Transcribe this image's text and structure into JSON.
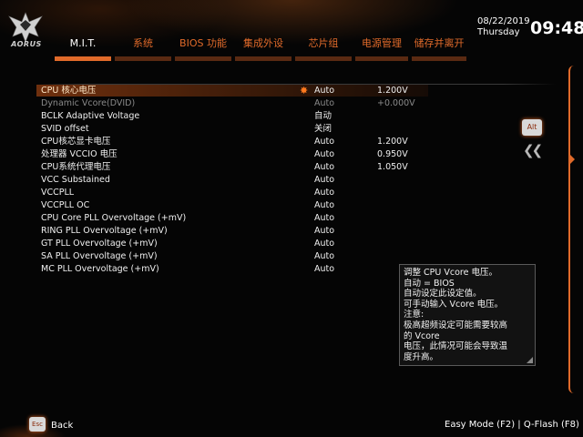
{
  "header": {
    "brand": "AORUS",
    "logo_icon": "eagle-icon",
    "date": "08/22/2019",
    "day": "Thursday",
    "time": "09:48",
    "accent_color": "#e06a2a"
  },
  "tabs": [
    {
      "label": "M.I.T.",
      "active": true
    },
    {
      "label": "系统",
      "active": false
    },
    {
      "label": "BIOS 功能",
      "active": false
    },
    {
      "label": "集成外设",
      "active": false
    },
    {
      "label": "芯片组",
      "active": false
    },
    {
      "label": "电源管理",
      "active": false
    },
    {
      "label": "储存并离开",
      "active": false
    }
  ],
  "settings": [
    {
      "label": "CPU 核心电压",
      "value": "Auto",
      "current": "1.200V",
      "selected": true,
      "dim": false
    },
    {
      "label": "Dynamic Vcore(DVID)",
      "value": "Auto",
      "current": "+0.000V",
      "selected": false,
      "dim": true
    },
    {
      "label": "BCLK Adaptive Voltage",
      "value": "自动",
      "current": "",
      "selected": false,
      "dim": false
    },
    {
      "label": "SVID offset",
      "value": "关闭",
      "current": "",
      "selected": false,
      "dim": false
    },
    {
      "label": "CPU核芯显卡电压",
      "value": "Auto",
      "current": "1.200V",
      "selected": false,
      "dim": false
    },
    {
      "label": "处理器 VCCIO 电压",
      "value": "Auto",
      "current": "0.950V",
      "selected": false,
      "dim": false
    },
    {
      "label": "CPU系统代理电压",
      "value": "Auto",
      "current": "1.050V",
      "selected": false,
      "dim": false
    },
    {
      "label": "VCC Substained",
      "value": "Auto",
      "current": "",
      "selected": false,
      "dim": false
    },
    {
      "label": "VCCPLL",
      "value": "Auto",
      "current": "",
      "selected": false,
      "dim": false
    },
    {
      "label": "VCCPLL OC",
      "value": "Auto",
      "current": "",
      "selected": false,
      "dim": false
    },
    {
      "label": "CPU Core PLL Overvoltage (+mV)",
      "value": "Auto",
      "current": "",
      "selected": false,
      "dim": false
    },
    {
      "label": "RING PLL Overvoltage (+mV)",
      "value": "Auto",
      "current": "",
      "selected": false,
      "dim": false
    },
    {
      "label": "GT PLL Overvoltage (+mV)",
      "value": "Auto",
      "current": "",
      "selected": false,
      "dim": false
    },
    {
      "label": "SA PLL Overvoltage (+mV)",
      "value": "Auto",
      "current": "",
      "selected": false,
      "dim": false
    },
    {
      "label": "MC PLL Overvoltage (+mV)",
      "value": "Auto",
      "current": "",
      "selected": false,
      "dim": false
    }
  ],
  "selected_marker_icon": "star-icon",
  "side": {
    "alt_label": "Alt",
    "collapse_icon": "double-chevron-left-icon"
  },
  "help": {
    "text": "调整 CPU Vcore 电压。\n自动 = BIOS\n自动设定此设定值。\n可手动输入 Vcore 电压。\n注意:\n极高超频设定可能需要较高\n的 Vcore\n电压，此情况可能会导致温\n度升高。"
  },
  "footer": {
    "esc_label": "Esc",
    "back_label": "Back",
    "shortcuts": "Easy Mode (F2)  |  Q-Flash (F8)"
  }
}
